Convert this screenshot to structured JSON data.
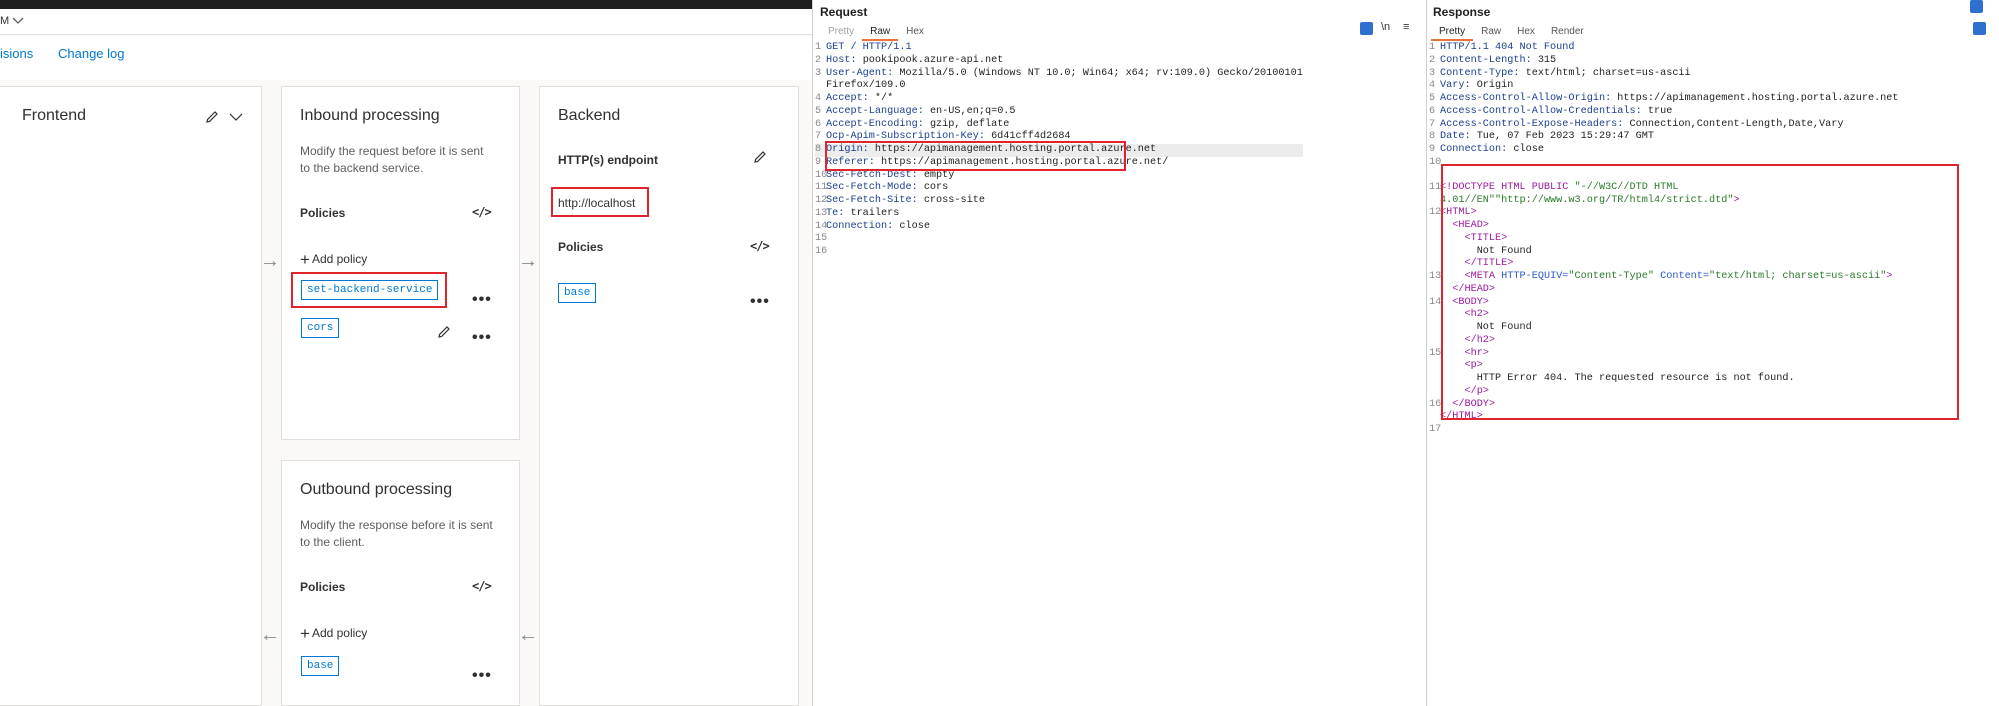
{
  "azure": {
    "breadcrumb_tail": "M",
    "nav": {
      "revisions": "isions",
      "changelog": "Change log"
    },
    "frontend": {
      "title": "Frontend"
    },
    "inbound": {
      "title": "Inbound processing",
      "desc1": "Modify the request before it is sent",
      "desc2": "to the backend service.",
      "policies_label": "Policies",
      "code_icon": "</>",
      "add_policy": "Add policy",
      "policy_1": "set-backend-service",
      "policy_2": "cors",
      "more": "•••"
    },
    "backend": {
      "title": "Backend",
      "endpoint_label": "HTTP(s) endpoint",
      "endpoint_url": "http://localhost",
      "policies_label": "Policies",
      "code_icon": "</>",
      "policy_1": "base",
      "more": "•••"
    },
    "outbound": {
      "title": "Outbound processing",
      "desc1": "Modify the response before it is sent",
      "desc2": "to the client.",
      "policies_label": "Policies",
      "code_icon": "</>",
      "add_policy": "Add policy",
      "policy_1": "base",
      "more": "•••"
    },
    "colors": {
      "accent": "#0078d4",
      "highlight": "#e0242b"
    }
  },
  "request": {
    "title": "Request",
    "tabs": [
      "Pretty",
      "Raw",
      "Hex"
    ],
    "active_tab": "Raw",
    "lines": [
      {
        "n": "1",
        "k": "GET / HTTP/1.1",
        "v": ""
      },
      {
        "n": "2",
        "k": "Host:",
        "v": " pookipook.azure-api.net"
      },
      {
        "n": "3",
        "k": "User-Agent:",
        "v": " Mozilla/5.0 (Windows NT 10.0; Win64; x64; rv:109.0) Gecko/20100101"
      },
      {
        "n": "",
        "k": "",
        "v": "Firefox/109.0"
      },
      {
        "n": "4",
        "k": "Accept:",
        "v": " */*"
      },
      {
        "n": "5",
        "k": "Accept-Language:",
        "v": " en-US,en;q=0.5"
      },
      {
        "n": "6",
        "k": "Accept-Encoding:",
        "v": " gzip, deflate"
      },
      {
        "n": "7",
        "k": "Ocp-Apim-Subscription-Key:",
        "v": " 6d41cff4d2684"
      },
      {
        "n": "8",
        "k": "Origin:",
        "v": " https://apimanagement.hosting.portal.azure.net"
      },
      {
        "n": "9",
        "k": "Referer:",
        "v": " https://apimanagement.hosting.portal.azure.net/"
      },
      {
        "n": "10",
        "k": "Sec-Fetch-Dest:",
        "v": " empty"
      },
      {
        "n": "11",
        "k": "Sec-Fetch-Mode:",
        "v": " cors"
      },
      {
        "n": "12",
        "k": "Sec-Fetch-Site:",
        "v": " cross-site"
      },
      {
        "n": "13",
        "k": "Te:",
        "v": " trailers"
      },
      {
        "n": "14",
        "k": "Connection:",
        "v": " close"
      },
      {
        "n": "15",
        "k": "",
        "v": ""
      },
      {
        "n": "16",
        "k": "",
        "v": ""
      }
    ]
  },
  "response": {
    "title": "Response",
    "tabs": [
      "Pretty",
      "Raw",
      "Hex",
      "Render"
    ],
    "active_tab": "Pretty",
    "headers": [
      {
        "n": "1",
        "k": "HTTP/1.1 404 Not Found",
        "v": ""
      },
      {
        "n": "2",
        "k": "Content-Length:",
        "v": " 315"
      },
      {
        "n": "3",
        "k": "Content-Type:",
        "v": " text/html; charset=us-ascii"
      },
      {
        "n": "4",
        "k": "Vary:",
        "v": " Origin"
      },
      {
        "n": "5",
        "k": "Access-Control-Allow-Origin:",
        "v": " https://apimanagement.hosting.portal.azure.net"
      },
      {
        "n": "6",
        "k": "Access-Control-Allow-Credentials:",
        "v": " true"
      },
      {
        "n": "7",
        "k": "Access-Control-Expose-Headers:",
        "v": " Connection,Content-Length,Date,Vary"
      },
      {
        "n": "8",
        "k": "Date:",
        "v": " Tue, 07 Feb 2023 15:29:47 GMT"
      },
      {
        "n": "9",
        "k": "Connection:",
        "v": " close"
      },
      {
        "n": "10",
        "k": "",
        "v": ""
      }
    ],
    "body": {
      "doctype_a": "<!DOCTYPE HTML PUBLIC ",
      "doctype_str1": "\"-//W3C//DTD HTML",
      "doctype_str2": "4.01//EN\"",
      "doctype_str3": "\"http://www.w3.org/TR/html4/strict.dtd\"",
      "doctype_close": ">",
      "html_open": "<HTML>",
      "head_open": "<HEAD>",
      "title_open": "<TITLE>",
      "title_text": "Not Found",
      "title_close": "</TITLE>",
      "meta_a": "<META ",
      "meta_attr1": "HTTP-EQUIV=",
      "meta_val1": "\"Content-Type\"",
      "meta_attr2": " Content=",
      "meta_val2": "\"text/html; charset=us-ascii\"",
      "meta_close": ">",
      "head_close": "</HEAD>",
      "body_open": "<BODY>",
      "h2_open": "<h2>",
      "h2_text": "Not Found",
      "h2_close": "</h2>",
      "hr": "<hr>",
      "p_open": "<p>",
      "p_text": "HTTP Error 404. The requested resource is not found.",
      "p_close": "</p>",
      "body_close": "</BODY>",
      "html_close": "</HTML>",
      "n11": "11",
      "n12": "12",
      "n13": "13",
      "n14": "14",
      "n15": "15",
      "n16": "16",
      "n17": "17"
    }
  }
}
